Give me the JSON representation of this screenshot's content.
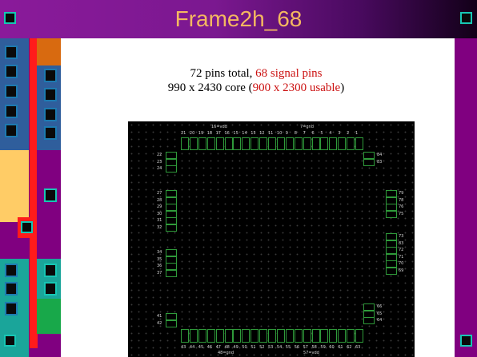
{
  "slide": {
    "title": "Frame2h_68",
    "line1_prefix": "72 pins total, ",
    "line1_highlight": "68 signal pins",
    "line2_prefix": "990 x 2430 core (",
    "line2_highlight": "900 x 2300 usable",
    "line2_suffix": ")"
  },
  "colors": {
    "title_text": "#f4b860",
    "highlight_text": "#cc1111",
    "chip_pad_border": "#2f9a3a",
    "accent_purple": "#800080"
  },
  "chip": {
    "top_label_a": "16=vdd",
    "top_label_b": "7=gnd",
    "bottom_label_a": "48=gnd",
    "bottom_label_b": "57=vdd",
    "top_pins": [
      "21",
      "20",
      "19",
      "18",
      "17",
      "16",
      "15",
      "14",
      "13",
      "12",
      "11",
      "10",
      "9",
      "8",
      "7",
      "6",
      "5",
      "4",
      "3",
      "2",
      "1"
    ],
    "bottom_pins": [
      "43",
      "44",
      "45",
      "46",
      "47",
      "48",
      "49",
      "50",
      "51",
      "52",
      "53",
      "54",
      "55",
      "56",
      "57",
      "58",
      "59",
      "60",
      "61",
      "62",
      "63"
    ],
    "left_pins_a": [
      "22",
      "23",
      "24"
    ],
    "left_pins_b": [
      "27",
      "28",
      "29",
      "30",
      "31",
      "32"
    ],
    "left_pins_c": [
      "34",
      "35",
      "36",
      "37"
    ],
    "left_pins_d": [
      "41",
      "42"
    ],
    "right_pins_a": [
      "84",
      "83"
    ],
    "right_pins_b": [
      "79",
      "78",
      "76",
      "75"
    ],
    "right_pins_c": [
      "73",
      "83",
      "72",
      "71",
      "70",
      "69"
    ],
    "right_pins_d": [
      "66",
      "65",
      "64"
    ]
  }
}
